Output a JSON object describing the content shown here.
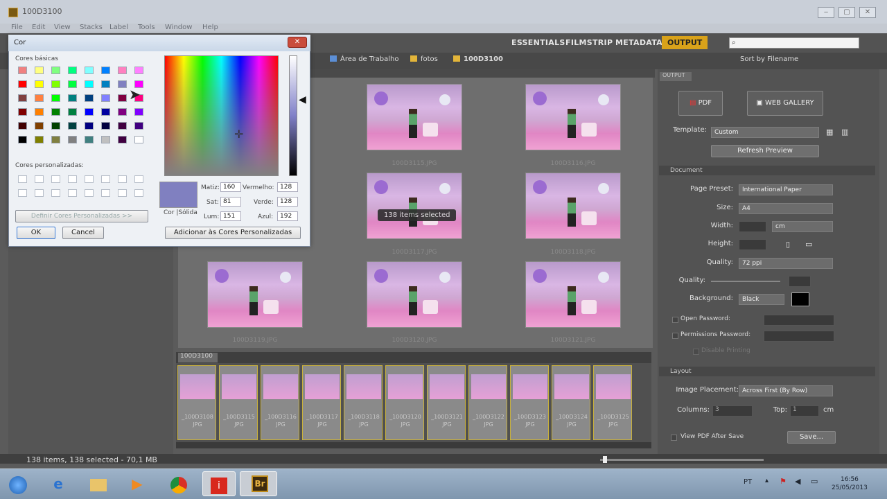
{
  "app": {
    "title": "100D3100",
    "menu": [
      "File",
      "Edit",
      "View",
      "Stacks",
      "Label",
      "Tools",
      "Window",
      "Help"
    ]
  },
  "workspaces": {
    "essentials": "ESSENTIALS",
    "filmstrip": "FILMSTRIP",
    "metadata": "METADATA",
    "output": "OUTPUT"
  },
  "search": {
    "placeholder": ""
  },
  "path": [
    "Área de Trabalho",
    "fotos",
    "100D3100"
  ],
  "sort_label": "Sort by Filename",
  "content": {
    "tooltip": "138 items selected",
    "thumb_labels": [
      "100D3115.JPG",
      "100D3116.JPG",
      "100D3117.JPG",
      "100D3118.JPG",
      "100D3119.JPG",
      "100D3120.JPG",
      "100D3121.JPG",
      "100D3122.JPG"
    ]
  },
  "filmstrip": {
    "tab": "100D3100",
    "items": [
      {
        "name": "_100D3108",
        "ext": "JPG"
      },
      {
        "name": "_100D3115",
        "ext": "JPG"
      },
      {
        "name": "_100D3116",
        "ext": "JPG"
      },
      {
        "name": "_100D3117",
        "ext": "JPG"
      },
      {
        "name": "_100D3118",
        "ext": "JPG"
      },
      {
        "name": "_100D3120",
        "ext": "JPG"
      },
      {
        "name": "_100D3121",
        "ext": "JPG"
      },
      {
        "name": "_100D3122",
        "ext": "JPG"
      },
      {
        "name": "_100D3123",
        "ext": "JPG"
      },
      {
        "name": "_100D3124",
        "ext": "JPG"
      },
      {
        "name": "_100D3125",
        "ext": "JPG"
      }
    ]
  },
  "output_panel": {
    "tab": "OUTPUT",
    "pdf_label": "PDF",
    "web_gallery_label": "WEB GALLERY",
    "template_label": "Template:",
    "template_value": "Custom",
    "refresh_label": "Refresh Preview",
    "document_section": "Document",
    "page_preset_label": "Page Preset:",
    "page_preset_value": "International Paper",
    "size_label": "Size:",
    "size_value": "A4",
    "width_label": "Width:",
    "unit_value": "cm",
    "height_label": "Height:",
    "quality_label": "Quality:",
    "quality_value": "72 ppi",
    "quality2_label": "Quality:",
    "background_label": "Background:",
    "background_value": "Black",
    "open_password_label": "Open Password:",
    "permissions_password_label": "Permissions Password:",
    "disable_printing_label": "Disable Printing",
    "layout_section": "Layout",
    "image_placement_label": "Image Placement:",
    "image_placement_value": "Across First (By Row)",
    "columns_label": "Columns:",
    "columns_value": "3",
    "top_label": "Top:",
    "top_value": "1",
    "top_unit": "cm",
    "view_pdf_label": "View PDF After Save",
    "save_label": "Save..."
  },
  "status": {
    "text": "138 items, 138 selected - 70,1 MB"
  },
  "taskbar": {
    "br_label": "Br",
    "lang": "PT",
    "time": "16:56",
    "date": "25/05/2013"
  },
  "color_dialog": {
    "title": "Cor",
    "basic_colors_label": "Cores básicas",
    "custom_colors_label": "Cores personalizadas:",
    "define_custom_label": "Definir Cores Personalizadas >>",
    "ok_label": "OK",
    "cancel_label": "Cancel",
    "solid_label": "Cor |Sólida",
    "hue_label": "Matiz:",
    "hue_value": "160",
    "sat_label": "Sat:",
    "sat_value": "81",
    "lum_label": "Lum:",
    "lum_value": "151",
    "red_label": "Vermelho:",
    "red_value": "128",
    "green_label": "Verde:",
    "green_value": "128",
    "blue_label": "Azul:",
    "blue_value": "192",
    "add_custom_label": "Adicionar às Cores Personalizadas",
    "swatches": [
      "#f08080",
      "#ffff80",
      "#80ff80",
      "#00ff80",
      "#80ffff",
      "#0080ff",
      "#ff80c0",
      "#ff80ff",
      "#ff0000",
      "#ffff00",
      "#80ff00",
      "#00ff40",
      "#00ffff",
      "#0080c0",
      "#8080c0",
      "#ff00ff",
      "#804040",
      "#ff8040",
      "#00ff00",
      "#008080",
      "#004080",
      "#8080ff",
      "#800040",
      "#ff0080",
      "#800000",
      "#ff8000",
      "#008000",
      "#008040",
      "#0000ff",
      "#0000a0",
      "#800080",
      "#8000ff",
      "#400000",
      "#804000",
      "#004000",
      "#004040",
      "#000080",
      "#000040",
      "#400040",
      "#400080",
      "#000000",
      "#808000",
      "#808040",
      "#808080",
      "#408080",
      "#c0c0c0",
      "#400040",
      "#ffffff"
    ],
    "selected_color": "#8080c0"
  }
}
